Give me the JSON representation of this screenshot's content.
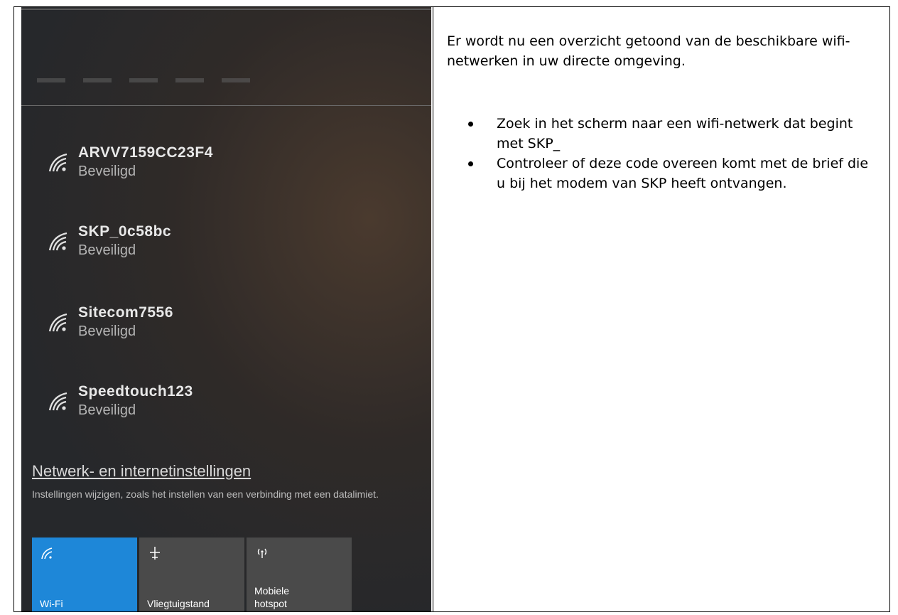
{
  "networks": [
    {
      "name": "ARVV7159CC23F4",
      "status": "Beveiligd",
      "icon": "wifi-icon"
    },
    {
      "name": "SKP_0c58bc",
      "status": "Beveiligd",
      "icon": "wifi-icon"
    },
    {
      "name": "Sitecom7556",
      "status": "Beveiligd",
      "icon": "wifi-icon"
    },
    {
      "name": "Speedtouch123",
      "status": "Beveiligd",
      "icon": "wifi-icon"
    }
  ],
  "settings": {
    "link": "Netwerk- en internetinstellingen",
    "description": "Instellingen wijzigen, zoals het instellen van een verbinding met een datalimiet."
  },
  "quick_actions": [
    {
      "label": "Wi-Fi",
      "icon": "wifi-icon",
      "active": true
    },
    {
      "label": "Vliegtuigstand",
      "icon": "airplane-icon",
      "active": false
    },
    {
      "label": "Mobiele\nhotspot",
      "icon": "hotspot-icon",
      "active": false
    }
  ],
  "instructions": {
    "intro": "Er wordt nu een overzicht getoond van de beschikbare wifi-netwerken in uw directe omgeving.",
    "bullets": [
      "Zoek in het scherm naar een wifi-netwerk dat begint met SKP_",
      "Controleer of deze code overeen komt met de brief die u bij het modem van SKP heeft ontvangen."
    ]
  },
  "colors": {
    "accent": "#1e87d8",
    "panel_bg": "#26282b",
    "tile_bg": "#4a4a4a"
  }
}
